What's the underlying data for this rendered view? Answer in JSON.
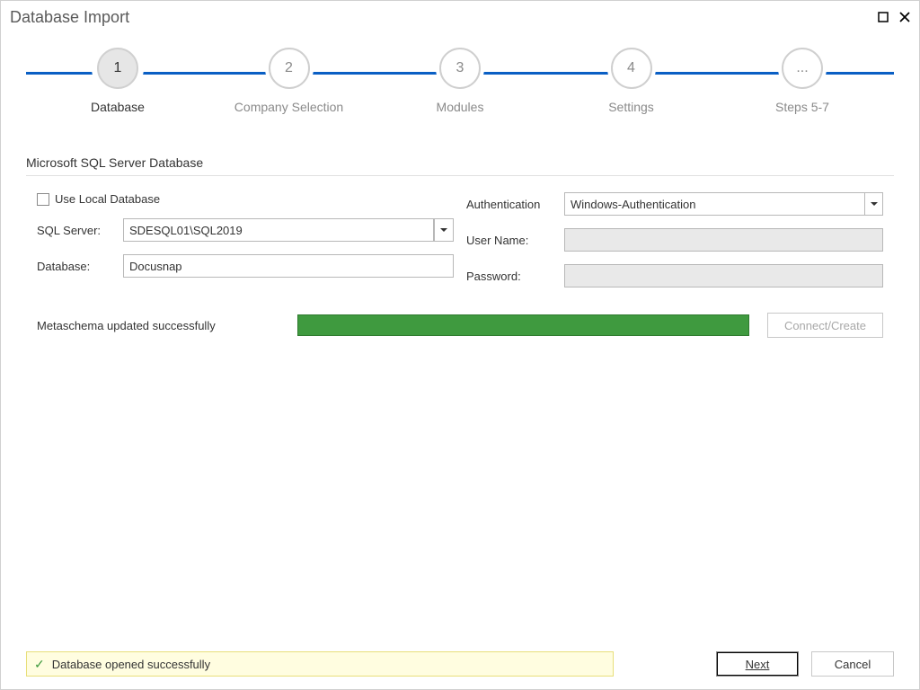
{
  "window": {
    "title": "Database Import"
  },
  "wizard": {
    "steps": [
      {
        "num": "1",
        "label": "Database",
        "active": true
      },
      {
        "num": "2",
        "label": "Company Selection",
        "active": false
      },
      {
        "num": "3",
        "label": "Modules",
        "active": false
      },
      {
        "num": "4",
        "label": "Settings",
        "active": false
      },
      {
        "num": "...",
        "label": "Steps 5-7",
        "active": false
      }
    ]
  },
  "section": {
    "title": "Microsoft SQL Server Database"
  },
  "form": {
    "use_local_label": "Use Local Database",
    "sql_server_label": "SQL Server:",
    "sql_server_value": "SDESQL01\\SQL2019",
    "database_label": "Database:",
    "database_value": "Docusnap",
    "auth_label": "Authentication",
    "auth_value": "Windows-Authentication",
    "user_label": "User Name:",
    "user_value": "",
    "password_label": "Password:",
    "password_value": "",
    "metaschema_status": "Metaschema updated successfully",
    "connect_button": "Connect/Create"
  },
  "footer": {
    "notice": "Database opened successfully",
    "next": "Next",
    "cancel": "Cancel"
  }
}
